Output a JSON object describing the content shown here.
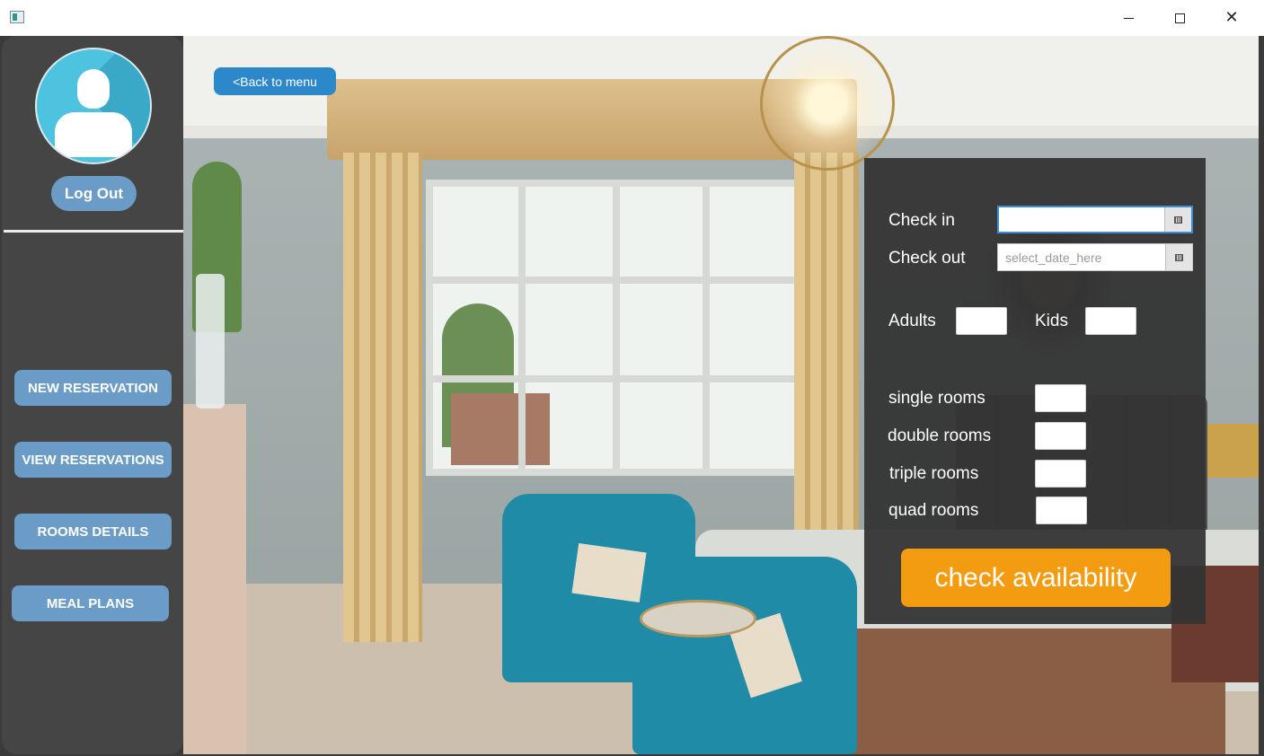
{
  "window": {
    "icons": {
      "minimize": "minimize-icon",
      "maximize": "maximize-icon",
      "close": "close-icon",
      "close_glyph": "✕"
    }
  },
  "sidebar": {
    "avatar_icon": "user-avatar-icon",
    "logout_label": "Log Out",
    "menu": [
      {
        "label": "NEW RESERVATION"
      },
      {
        "label": "VIEW RESERVATIONS"
      },
      {
        "label": "ROOMS DETAILS"
      },
      {
        "label": "MEAL PLANS"
      }
    ]
  },
  "header": {
    "back_label": "<Back to menu"
  },
  "form": {
    "check_in": {
      "label": "Check in",
      "value": "",
      "placeholder": ""
    },
    "check_out": {
      "label": "Check out",
      "value": "",
      "placeholder": "select_date_here"
    },
    "calendar_icon": "calendar-icon",
    "adults": {
      "label": "Adults",
      "value": ""
    },
    "kids": {
      "label": "Kids",
      "value": ""
    },
    "rooms": [
      {
        "label": "single rooms",
        "value": ""
      },
      {
        "label": "double rooms",
        "value": ""
      },
      {
        "label": "triple rooms",
        "value": ""
      },
      {
        "label": "quad rooms",
        "value": ""
      }
    ],
    "submit_label": "check availability"
  },
  "colors": {
    "sidebar_bg": "#454545",
    "sidebar_button": "#6a9cc7",
    "back_button": "#2c88c9",
    "panel_bg": "#343434",
    "primary_action": "#f39c12",
    "avatar": "#4ec3e0"
  }
}
